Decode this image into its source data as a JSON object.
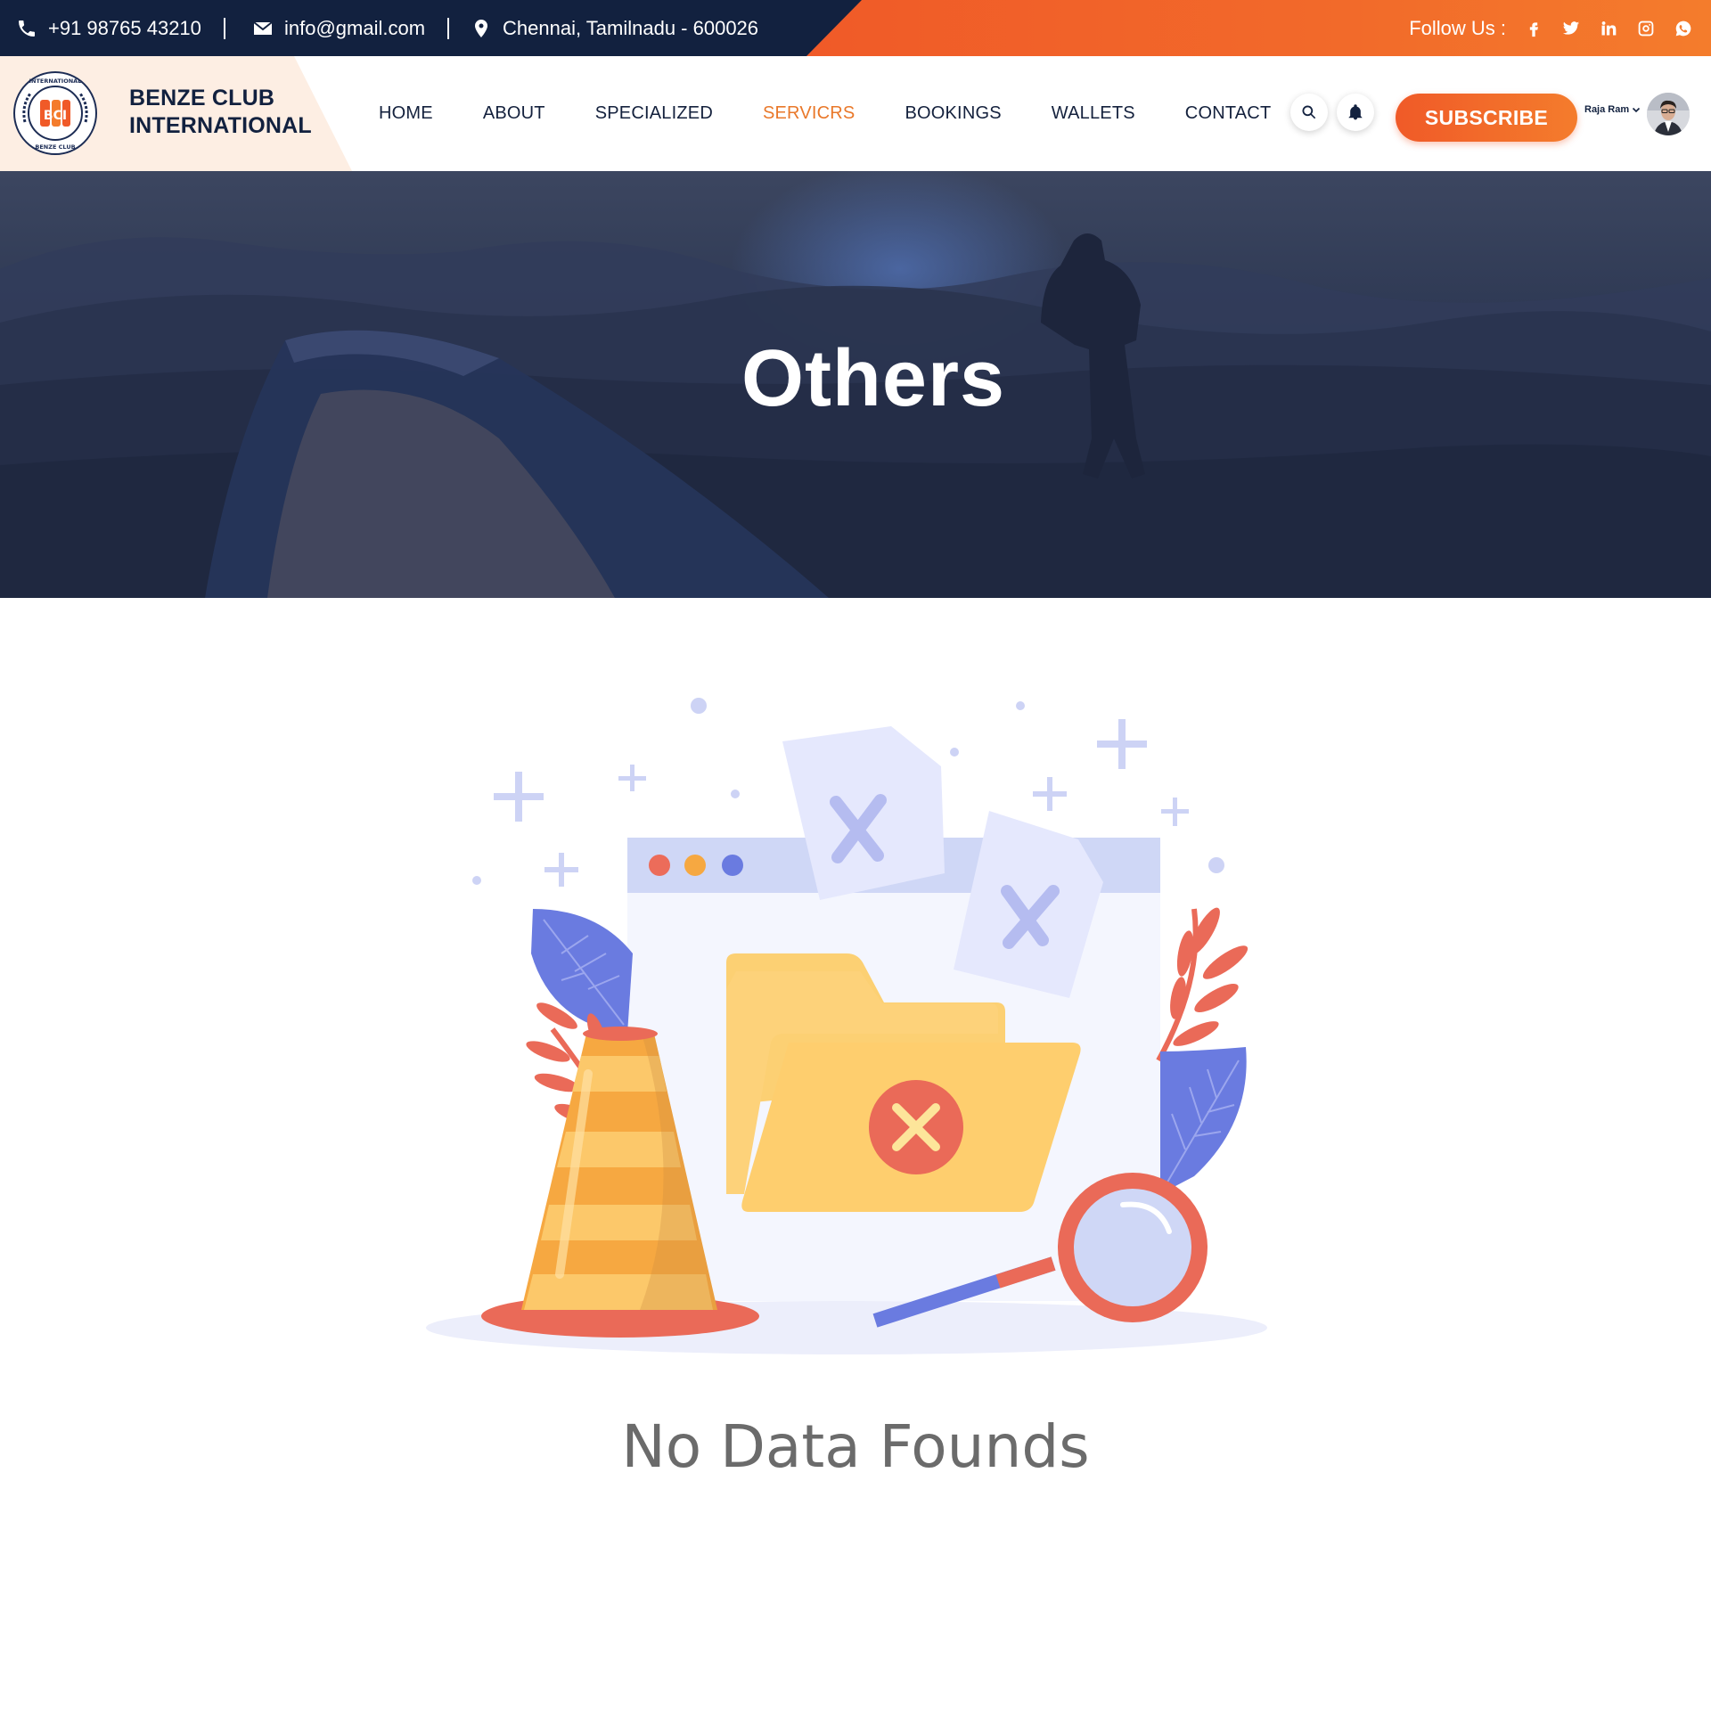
{
  "topbar": {
    "phone": "+91 98765 43210",
    "email": "info@gmail.com",
    "address": "Chennai, Tamilnadu - 600026",
    "follow_label": "Follow Us :",
    "socials": [
      "facebook-icon",
      "twitter-icon",
      "linkedin-icon",
      "instagram-icon",
      "whatsapp-icon"
    ]
  },
  "brand": {
    "name_line1": "BENZE CLUB",
    "name_line2": "INTERNATIONAL",
    "logo_text_top": "INTERNATIONAL",
    "logo_monogram": "BCI",
    "logo_text_bottom": "BENZE CLUB"
  },
  "nav": {
    "items": [
      "HOME",
      "ABOUT",
      "SPECIALIZED",
      "SERVICRS",
      "BOOKINGS",
      "WALLETS",
      "CONTACT"
    ],
    "active": "SERVICRS"
  },
  "header_actions": {
    "subscribe_label": "SUBSCRIBE",
    "user_name": "Raja Ram"
  },
  "hero": {
    "title": "Others"
  },
  "empty_state": {
    "message": "No Data Founds"
  },
  "colors": {
    "navy": "#12213f",
    "orange": "#f05a28",
    "active_nav": "#e9782a",
    "muted_text": "#6b6b6b"
  }
}
